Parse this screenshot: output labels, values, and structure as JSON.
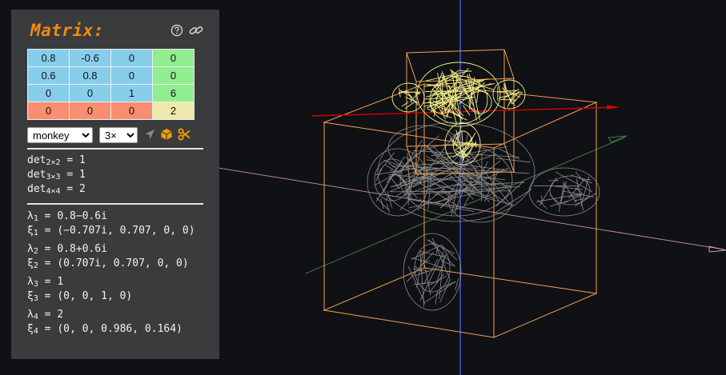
{
  "panel": {
    "title": "Matrix:",
    "icons": [
      "help-icon",
      "link-icon"
    ],
    "matrix": [
      [
        {
          "v": "0.8",
          "c": "blue"
        },
        {
          "v": "-0.6",
          "c": "blue"
        },
        {
          "v": "0",
          "c": "blue"
        },
        {
          "v": "0",
          "c": "green"
        }
      ],
      [
        {
          "v": "0.6",
          "c": "blue"
        },
        {
          "v": "0.8",
          "c": "blue"
        },
        {
          "v": "0",
          "c": "blue"
        },
        {
          "v": "0",
          "c": "green"
        }
      ],
      [
        {
          "v": "0",
          "c": "blue"
        },
        {
          "v": "0",
          "c": "blue"
        },
        {
          "v": "1",
          "c": "blue"
        },
        {
          "v": "6",
          "c": "green"
        }
      ],
      [
        {
          "v": "0",
          "c": "salmon"
        },
        {
          "v": "0",
          "c": "salmon"
        },
        {
          "v": "0",
          "c": "salmon"
        },
        {
          "v": "2",
          "c": "wheat"
        }
      ]
    ],
    "model_select": "monkey",
    "scale_select": "3×",
    "tool_icons": [
      "navigate-icon",
      "cube-icon",
      "scissors-icon"
    ],
    "det": [
      {
        "sub": "2×2",
        "value": "1"
      },
      {
        "sub": "3×3",
        "value": "1"
      },
      {
        "sub": "4×4",
        "value": "2"
      }
    ],
    "eigen": [
      {
        "i": "1",
        "lambda": "0.8−0.6i",
        "xi": "(−0.707i, 0.707, 0, 0)"
      },
      {
        "i": "2",
        "lambda": "0.8+0.6i",
        "xi": "(0.707i, 0.707, 0, 0)"
      },
      {
        "i": "3",
        "lambda": "1",
        "xi": "(0, 0, 1, 0)"
      },
      {
        "i": "4",
        "lambda": "2",
        "xi": "(0, 0, 0.986, 0.164)"
      }
    ]
  },
  "colors": {
    "background": "#0f1114",
    "panel": "#3a3b3c",
    "title": "#f08a10",
    "blue": "#87ceeb",
    "green": "#90ee90",
    "salmon": "#fa8e70",
    "wheat": "#eee8aa",
    "wire_original": "#8c8c8c",
    "wire_transformed": "#f5f08a",
    "bbox": "#f0a050",
    "axis_x": "#d40000",
    "axis_y": "#4040ff",
    "axis_z": "#4a7a4a"
  }
}
